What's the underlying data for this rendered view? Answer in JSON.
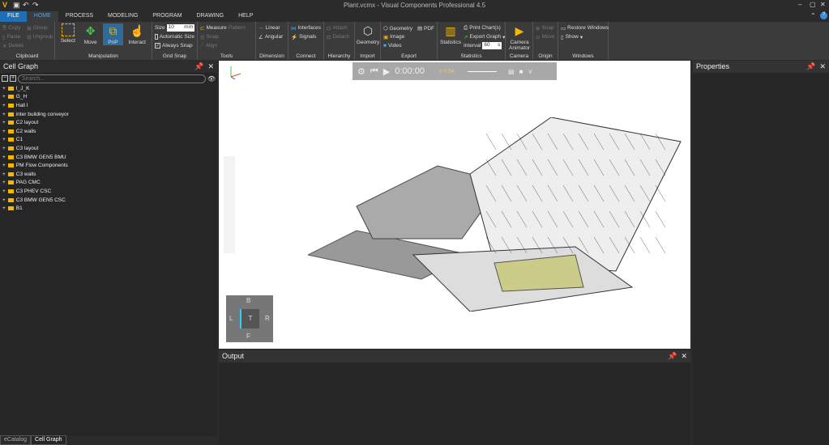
{
  "window": {
    "title": "Plant.vcmx - Visual Components Professional 4.5"
  },
  "tabs": [
    "FILE",
    "HOME",
    "PROCESS",
    "MODELING",
    "PROGRAM",
    "DRAWING",
    "HELP"
  ],
  "ribbon": {
    "clipboard": {
      "label": "Clipboard",
      "items": [
        "Copy",
        "Paste",
        "Delete",
        "Group",
        "Ungroup"
      ]
    },
    "manipulation": {
      "label": "Manipulation",
      "items": [
        "Select",
        "Move",
        "PnP",
        "Interact"
      ]
    },
    "grid_snap": {
      "label": "Grid Snap",
      "size_label": "Size",
      "size_value": "10",
      "size_unit": "mm",
      "automatic_size": "Automatic Size",
      "automatic_size_checked": false,
      "always_snap": "Always Snap",
      "always_snap_checked": true
    },
    "tools": {
      "label": "Tools",
      "items": [
        "Measure",
        "Pattern",
        "Snap",
        "Align"
      ]
    },
    "dimension": {
      "label": "Dimension",
      "items": [
        "Linear",
        "Angular"
      ]
    },
    "connect": {
      "label": "Connect",
      "items": [
        "Interfaces",
        "Signals"
      ]
    },
    "hierarchy": {
      "label": "Hierarchy",
      "items": [
        "Attach",
        "Detach"
      ]
    },
    "import": {
      "label": "Import",
      "items": [
        "Geometry"
      ]
    },
    "export": {
      "label": "Export",
      "items": [
        "Geometry",
        "PDF",
        "Image",
        "Video"
      ]
    },
    "statistics": {
      "label": "Statistics",
      "items": [
        "Statistics",
        "Print Chart(s)",
        "Export Graph"
      ],
      "interval_label": "Interval",
      "interval_value": "60",
      "interval_unit": "s"
    },
    "camera": {
      "label": "Camera",
      "items": [
        "Camera Animator"
      ]
    },
    "origin": {
      "label": "Origin",
      "items": [
        "Snap",
        "Move"
      ]
    },
    "windows": {
      "label": "Windows",
      "items": [
        "Restore Windows",
        "Show"
      ]
    }
  },
  "cell_graph": {
    "title": "Cell Graph",
    "search_placeholder": "Search...",
    "items": [
      "I_J_K",
      "G_H",
      "Hall I",
      "inter building conveyor",
      "C2 layout",
      "C2 walls",
      "C1",
      "C3 layout",
      "C3 BMW GEN5 BMU",
      "PM Flow Components",
      "C3 walls",
      "PAG CMC",
      "C3 PHEV CSC",
      "C3 BMW GEN5 CSC",
      "B1"
    ]
  },
  "playback": {
    "time": "0:00:00",
    "speed": "x 0.04"
  },
  "navcube": {
    "top": "B",
    "left": "L",
    "center": "T",
    "right": "R",
    "bottom": "F"
  },
  "output": {
    "title": "Output"
  },
  "properties": {
    "title": "Properties"
  },
  "bottom_tabs": [
    "eCatalog",
    "Cell Graph"
  ],
  "colors": {
    "accent": "#1e6fb3",
    "folder": "#f5b800",
    "background": "#2b2b2b"
  }
}
